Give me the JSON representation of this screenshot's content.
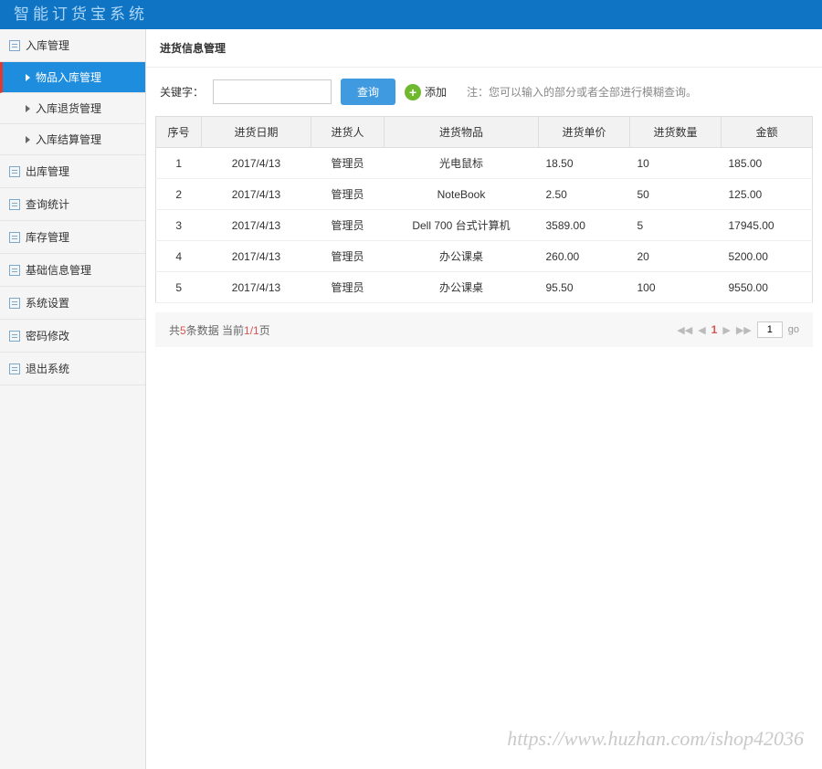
{
  "header": {
    "title": "智能订货宝系统"
  },
  "sidebar": {
    "items": [
      {
        "label": "入库管理",
        "expanded": true
      },
      {
        "label": "出库管理"
      },
      {
        "label": "查询统计"
      },
      {
        "label": "库存管理"
      },
      {
        "label": "基础信息管理"
      },
      {
        "label": "系统设置"
      },
      {
        "label": "密码修改"
      },
      {
        "label": "退出系统"
      }
    ],
    "sub_items": [
      {
        "label": "物品入库管理",
        "active": true
      },
      {
        "label": "入库退货管理"
      },
      {
        "label": "入库结算管理"
      }
    ]
  },
  "page": {
    "title": "进货信息管理",
    "keyword_label": "关键字：",
    "search_label": "查询",
    "add_label": "添加",
    "hint": "注：您可以输入的部分或者全部进行模糊查询。"
  },
  "table": {
    "headers": [
      "序号",
      "进货日期",
      "进货人",
      "进货物品",
      "进货单价",
      "进货数量",
      "金额"
    ],
    "rows": [
      [
        "1",
        "2017/4/13",
        "管理员",
        "光电鼠标",
        "18.50",
        "10",
        "185.00"
      ],
      [
        "2",
        "2017/4/13",
        "管理员",
        "NoteBook",
        "2.50",
        "50",
        "125.00"
      ],
      [
        "3",
        "2017/4/13",
        "管理员",
        "Dell 700 台式计算机",
        "3589.00",
        "5",
        "17945.00"
      ],
      [
        "4",
        "2017/4/13",
        "管理员",
        "办公课桌",
        "260.00",
        "20",
        "5200.00"
      ],
      [
        "5",
        "2017/4/13",
        "管理员",
        "办公课桌",
        "95.50",
        "100",
        "9550.00"
      ]
    ]
  },
  "pagination": {
    "summary_prefix": "共",
    "summary_count": "5",
    "summary_mid": "条数据 当前",
    "summary_page": "1/1",
    "summary_suffix": "页",
    "current": "1",
    "page_input": "1",
    "go_label": "go"
  },
  "watermark": "https://www.huzhan.com/ishop42036"
}
